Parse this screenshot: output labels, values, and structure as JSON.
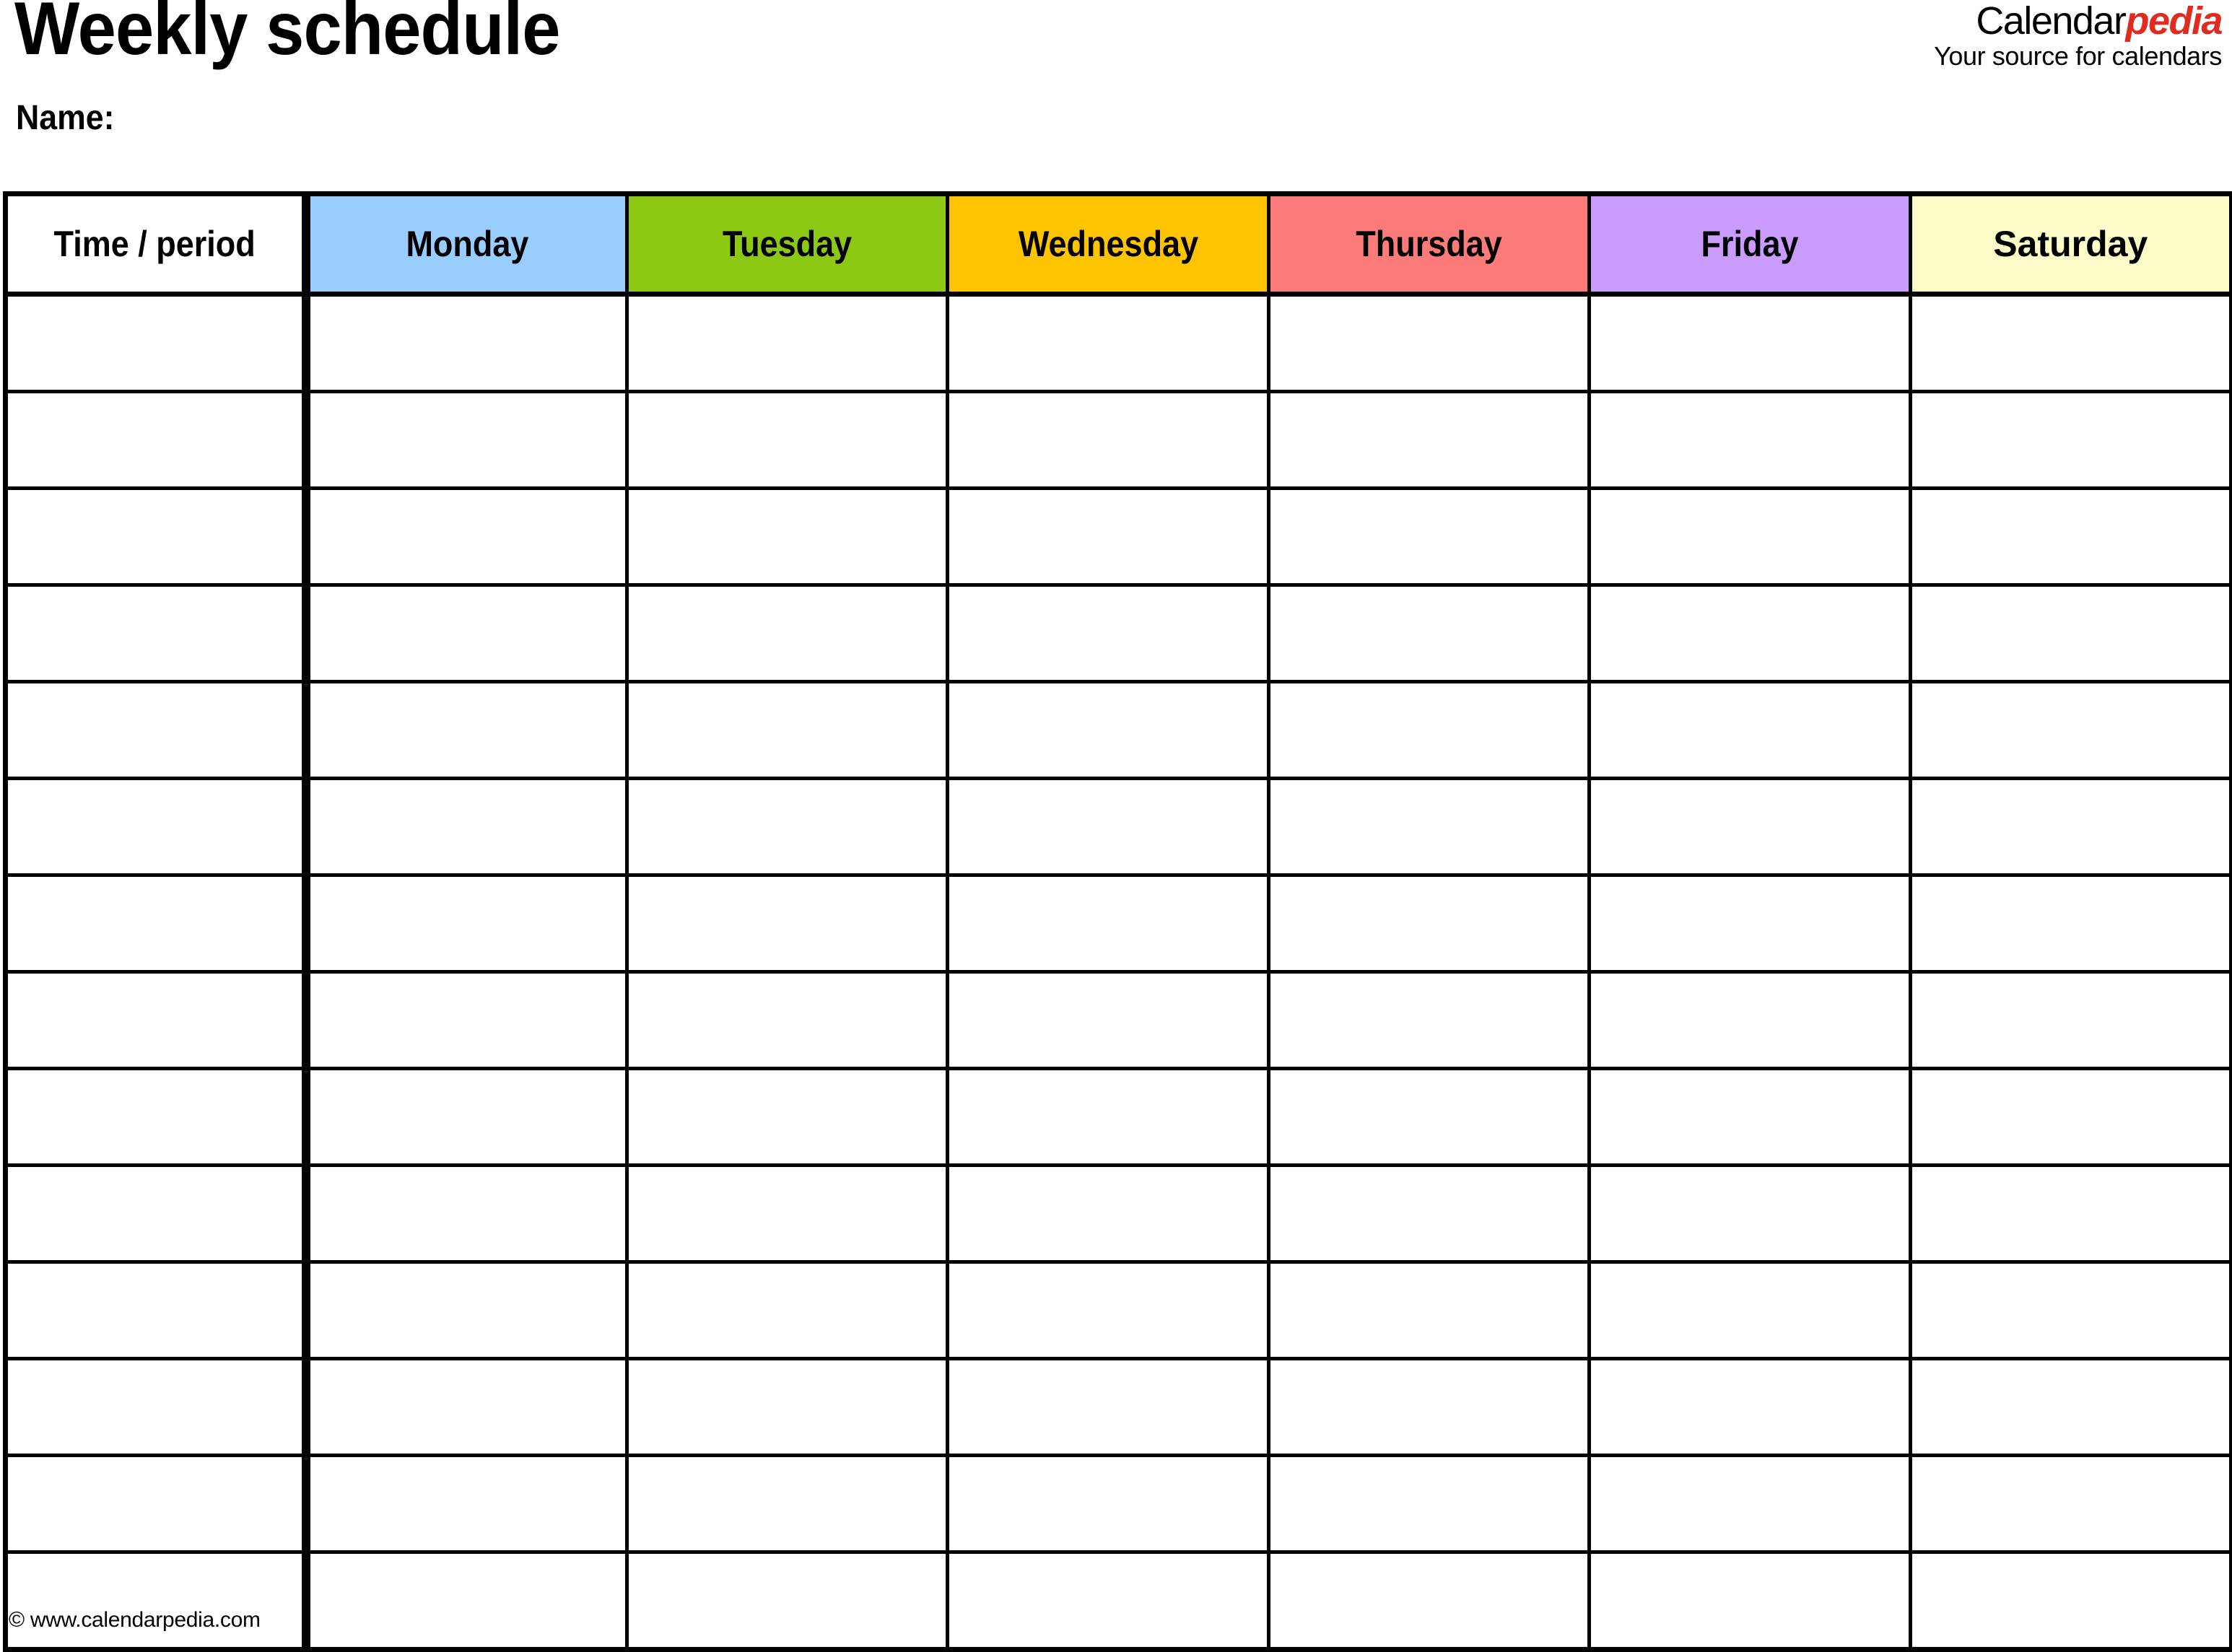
{
  "document": {
    "title": "Weekly schedule",
    "name_label": "Name:"
  },
  "brand": {
    "name_part_1": "Calendar",
    "name_part_2": "pedia",
    "tagline": "Your source for calendars",
    "accent_color": "#E02B20"
  },
  "table": {
    "columns": [
      {
        "label": "Time / period",
        "bg": "#FFFFFF",
        "key": "time"
      },
      {
        "label": "Monday",
        "bg": "#99CCFF",
        "key": "monday"
      },
      {
        "label": "Tuesday",
        "bg": "#8CC814",
        "key": "tuesday"
      },
      {
        "label": "Wednesday",
        "bg": "#FFC400",
        "key": "wednesday"
      },
      {
        "label": "Thursday",
        "bg": "#FB7B7B",
        "key": "thursday"
      },
      {
        "label": "Friday",
        "bg": "#C89BFC",
        "key": "friday"
      },
      {
        "label": "Saturday",
        "bg": "#FCFCC8",
        "key": "saturday"
      }
    ],
    "row_count": 14,
    "rows": [
      {
        "time": "",
        "monday": "",
        "tuesday": "",
        "wednesday": "",
        "thursday": "",
        "friday": "",
        "saturday": ""
      },
      {
        "time": "",
        "monday": "",
        "tuesday": "",
        "wednesday": "",
        "thursday": "",
        "friday": "",
        "saturday": ""
      },
      {
        "time": "",
        "monday": "",
        "tuesday": "",
        "wednesday": "",
        "thursday": "",
        "friday": "",
        "saturday": ""
      },
      {
        "time": "",
        "monday": "",
        "tuesday": "",
        "wednesday": "",
        "thursday": "",
        "friday": "",
        "saturday": ""
      },
      {
        "time": "",
        "monday": "",
        "tuesday": "",
        "wednesday": "",
        "thursday": "",
        "friday": "",
        "saturday": ""
      },
      {
        "time": "",
        "monday": "",
        "tuesday": "",
        "wednesday": "",
        "thursday": "",
        "friday": "",
        "saturday": ""
      },
      {
        "time": "",
        "monday": "",
        "tuesday": "",
        "wednesday": "",
        "thursday": "",
        "friday": "",
        "saturday": ""
      },
      {
        "time": "",
        "monday": "",
        "tuesday": "",
        "wednesday": "",
        "thursday": "",
        "friday": "",
        "saturday": ""
      },
      {
        "time": "",
        "monday": "",
        "tuesday": "",
        "wednesday": "",
        "thursday": "",
        "friday": "",
        "saturday": ""
      },
      {
        "time": "",
        "monday": "",
        "tuesday": "",
        "wednesday": "",
        "thursday": "",
        "friday": "",
        "saturday": ""
      },
      {
        "time": "",
        "monday": "",
        "tuesday": "",
        "wednesday": "",
        "thursday": "",
        "friday": "",
        "saturday": ""
      },
      {
        "time": "",
        "monday": "",
        "tuesday": "",
        "wednesday": "",
        "thursday": "",
        "friday": "",
        "saturday": ""
      },
      {
        "time": "",
        "monday": "",
        "tuesday": "",
        "wednesday": "",
        "thursday": "",
        "friday": "",
        "saturday": ""
      },
      {
        "time": "",
        "monday": "",
        "tuesday": "",
        "wednesday": "",
        "thursday": "",
        "friday": "",
        "saturday": ""
      }
    ]
  },
  "footer": {
    "copyright": "© www.calendarpedia.com"
  }
}
